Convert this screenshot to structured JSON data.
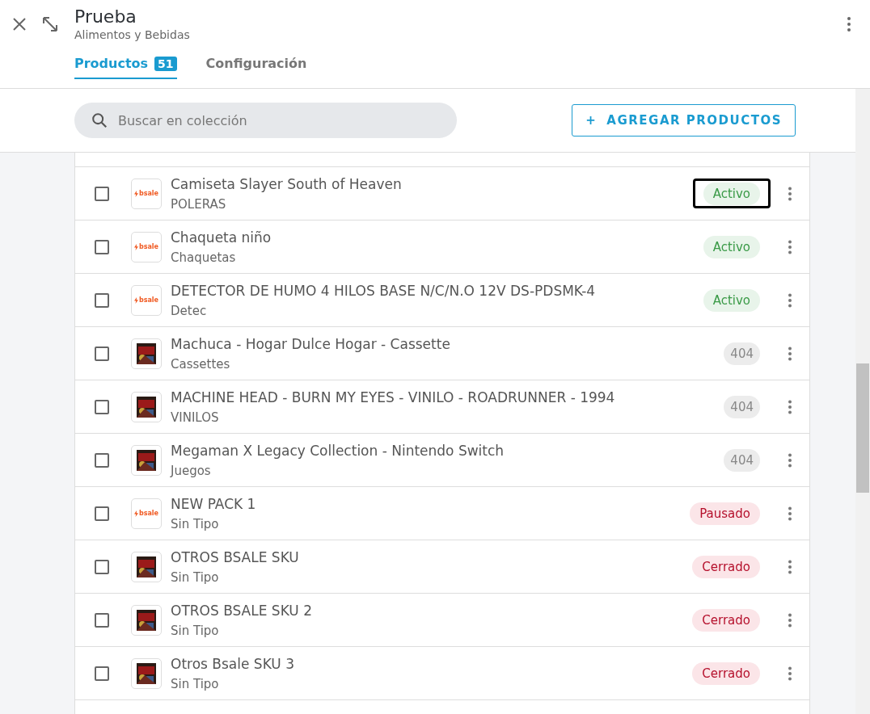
{
  "header": {
    "title": "Prueba",
    "subtitle": "Alimentos y Bebidas"
  },
  "tabs": [
    {
      "label": "Productos",
      "count": "51",
      "selected": true
    },
    {
      "label": "Configuración",
      "selected": false
    }
  ],
  "search": {
    "placeholder": "Buscar en colección"
  },
  "add_button": {
    "icon": "+",
    "label": "AGREGAR PRODUCTOS"
  },
  "products": [
    {
      "name": "Camiseta Slayer South of Heaven",
      "category": "POLERAS",
      "checked": false,
      "thumb": {
        "kind": "logo",
        "text": "bsale"
      },
      "status": {
        "label": "Activo",
        "kind": "active",
        "highlighted": true
      }
    },
    {
      "name": "Chaqueta niño",
      "category": "Chaquetas",
      "checked": false,
      "thumb": {
        "kind": "logo",
        "text": "bsale"
      },
      "status": {
        "label": "Activo",
        "kind": "active",
        "highlighted": false
      }
    },
    {
      "name": "DETECTOR DE HUMO 4 HILOS BASE N/C/N.O 12V DS-PDSMK-4",
      "category": "Detec",
      "checked": false,
      "thumb": {
        "kind": "logo",
        "text": "bsale"
      },
      "status": {
        "label": "Activo",
        "kind": "active",
        "highlighted": false
      }
    },
    {
      "name": "Machuca - Hogar Dulce Hogar - Cassette",
      "category": "Cassettes",
      "checked": false,
      "status": {
        "label": "404",
        "kind": "missing",
        "highlighted": false
      }
    },
    {
      "name": "MACHINE HEAD - BURN MY EYES - VINILO - ROADRUNNER - 1994",
      "category": "VINILOS",
      "checked": false,
      "status": {
        "label": "404",
        "kind": "missing",
        "highlighted": false
      }
    },
    {
      "name": "Megaman X Legacy Collection - Nintendo Switch",
      "category": "Juegos",
      "checked": false,
      "status": {
        "label": "404",
        "kind": "missing",
        "highlighted": false
      }
    },
    {
      "name": "NEW PACK 1",
      "category": "Sin Tipo",
      "checked": false,
      "thumb": {
        "kind": "logo",
        "text": "bsale"
      },
      "status": {
        "label": "Pausado",
        "kind": "paused",
        "highlighted": false
      }
    },
    {
      "name": "OTROS BSALE SKU",
      "category": "Sin Tipo",
      "checked": false,
      "status": {
        "label": "Cerrado",
        "kind": "closed",
        "highlighted": false
      }
    },
    {
      "name": "OTROS BSALE SKU 2",
      "category": "Sin Tipo",
      "checked": false,
      "status": {
        "label": "Cerrado",
        "kind": "closed",
        "highlighted": false
      }
    },
    {
      "name": "Otros Bsale SKU 3",
      "category": "Sin Tipo",
      "checked": false,
      "status": {
        "label": "Cerrado",
        "kind": "closed",
        "highlighted": false
      }
    }
  ]
}
